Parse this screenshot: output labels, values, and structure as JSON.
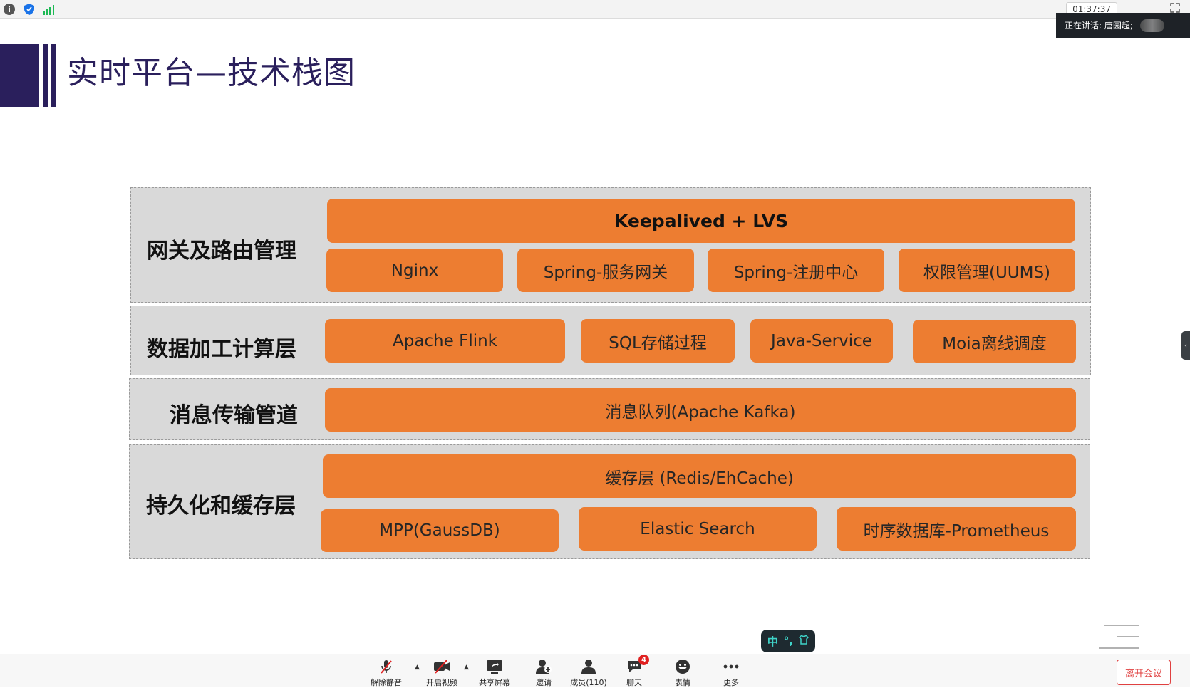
{
  "topbar": {
    "clock": "01:37:37",
    "speaking_label": "正在讲话: 唐园超;"
  },
  "slide": {
    "title": "实时平台—技术栈图",
    "layers": [
      {
        "label": "网关及路由管理",
        "rows": [
          [
            "Keepalived + LVS"
          ],
          [
            "Nginx",
            "Spring-服务网关",
            "Spring-注册中心",
            "权限管理(UUMS)"
          ]
        ]
      },
      {
        "label": "数据加工计算层",
        "rows": [
          [
            "Apache Flink",
            "SQL存储过程",
            "Java-Service",
            "Moia离线调度"
          ]
        ]
      },
      {
        "label": "消息传输管道",
        "rows": [
          [
            "消息队列(Apache Kafka)"
          ]
        ]
      },
      {
        "label": "持久化和缓存层",
        "rows": [
          [
            "缓存层 (Redis/EhCache)"
          ],
          [
            "MPP(GaussDB)",
            "Elastic Search",
            "时序数据库-Prometheus"
          ]
        ]
      }
    ]
  },
  "ime": {
    "lang": "中",
    "punct": "°,",
    "shirt": "⌂"
  },
  "toolbar": {
    "mute": "解除静音",
    "video": "开启视频",
    "share": "共享屏幕",
    "invite": "邀请",
    "members": "成员(110)",
    "chat": "聊天",
    "chat_badge": "4",
    "reactions": "表情",
    "more": "更多",
    "leave": "离开会议"
  },
  "colors": {
    "accent_orange": "#ed7d31",
    "layer_gray": "#d9d9d9",
    "title_navy": "#2a1f5c"
  }
}
